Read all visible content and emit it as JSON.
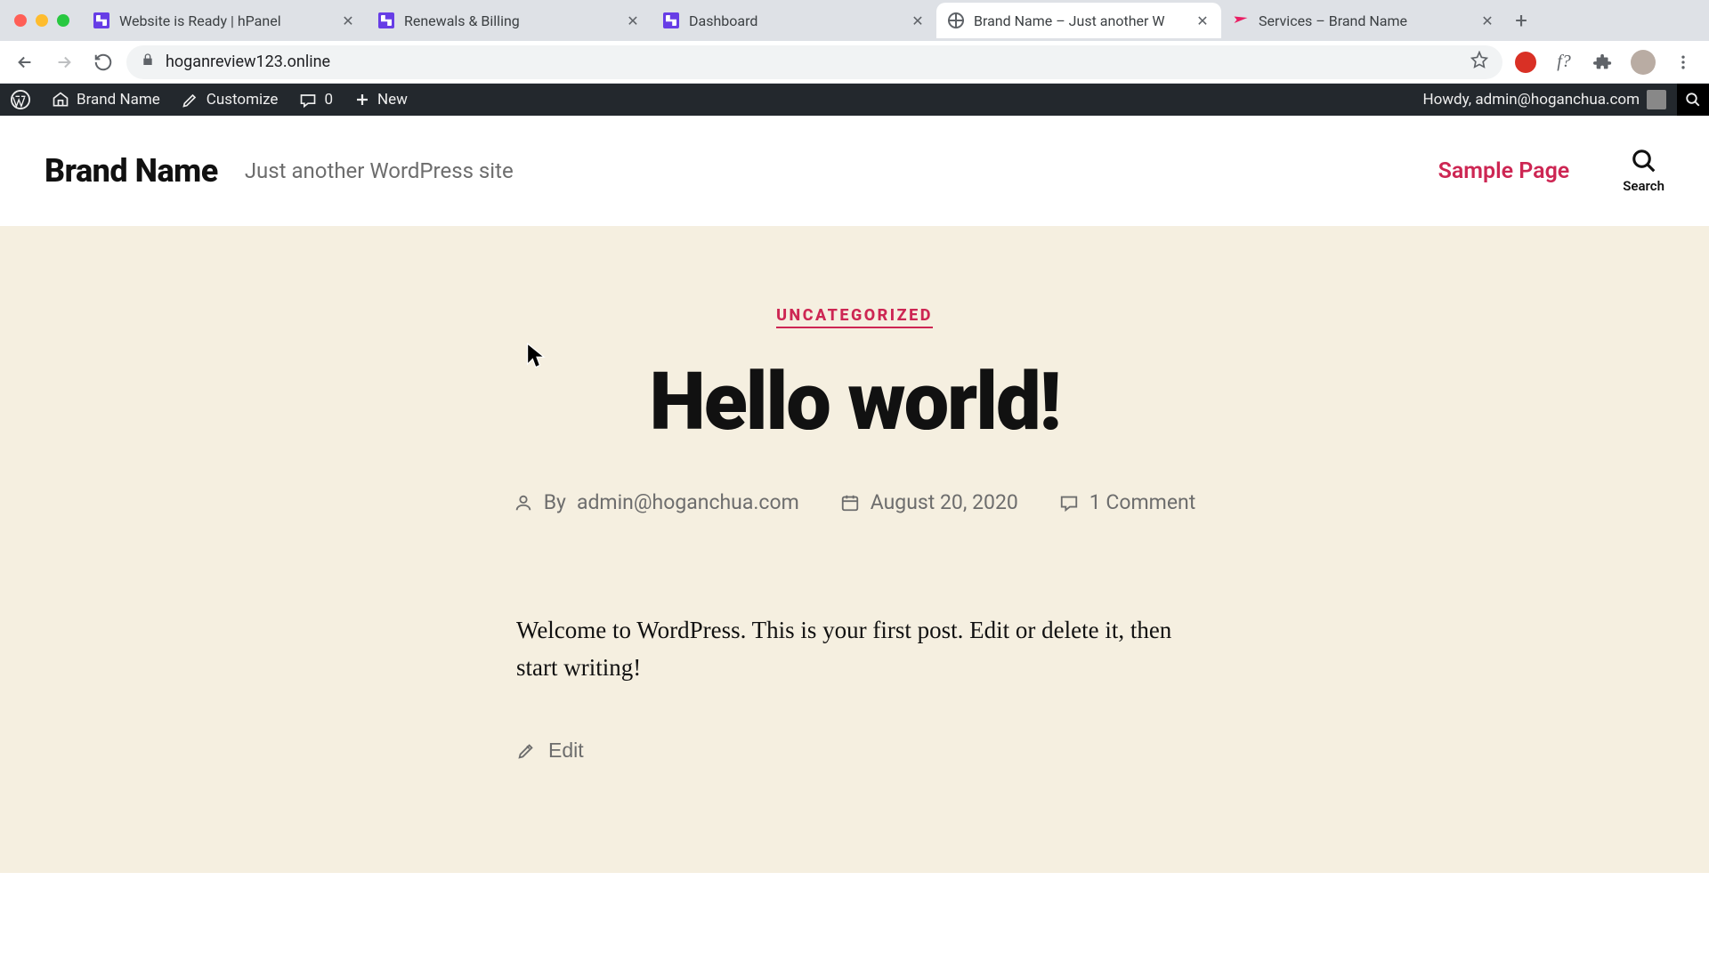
{
  "browser": {
    "tabs": [
      {
        "title": "Website is Ready | hPanel",
        "favicon": "hostinger",
        "active": false
      },
      {
        "title": "Renewals & Billing",
        "favicon": "hostinger",
        "active": false
      },
      {
        "title": "Dashboard",
        "favicon": "hostinger",
        "active": false
      },
      {
        "title": "Brand Name – Just another W",
        "favicon": "globe",
        "active": true
      },
      {
        "title": "Services – Brand Name",
        "favicon": "plane",
        "active": false
      }
    ],
    "url": "hoganreview123.online"
  },
  "adminbar": {
    "site_name": "Brand Name",
    "customize": "Customize",
    "comments_count": "0",
    "new": "New",
    "howdy": "Howdy, admin@hoganchua.com"
  },
  "header": {
    "site_title": "Brand Name",
    "tagline": "Just another WordPress site",
    "nav_link": "Sample Page",
    "search_label": "Search"
  },
  "post": {
    "category": "UNCATEGORIZED",
    "title": "Hello world!",
    "by_prefix": "By ",
    "author": "admin@hoganchua.com",
    "date": "August 20, 2020",
    "comments": "1 Comment",
    "content": "Welcome to WordPress. This is your first post. Edit or delete it, then start writing!",
    "edit": "Edit"
  }
}
